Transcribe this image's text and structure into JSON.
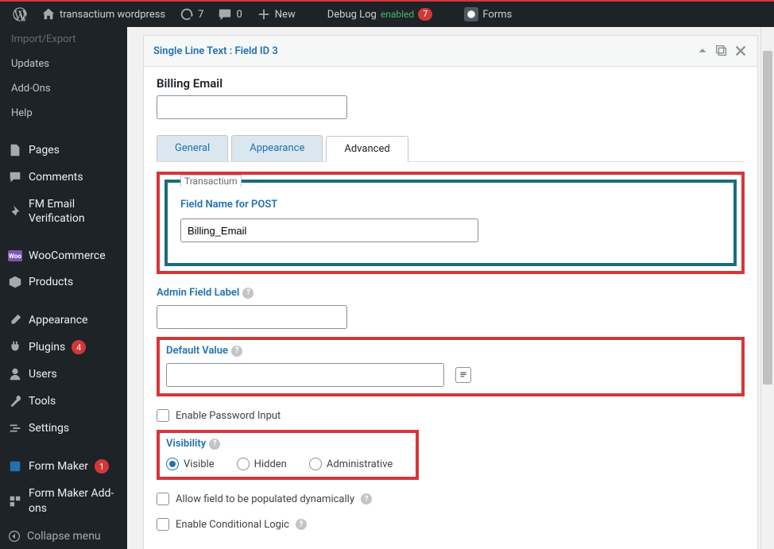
{
  "adminbar": {
    "site_name": "transactium wordpress",
    "updates_count": "7",
    "comments_count": "0",
    "new_label": "New",
    "debug_label": "Debug Log",
    "debug_status": "enabled",
    "debug_badge": "7",
    "forms_label": "Forms"
  },
  "sidebar": {
    "items_top": [
      "Import/Export",
      "Updates",
      "Add-Ons",
      "Help"
    ],
    "pages": "Pages",
    "comments": "Comments",
    "fm_email": "FM Email Verification",
    "woocommerce": "WooCommerce",
    "products": "Products",
    "appearance": "Appearance",
    "plugins": "Plugins",
    "plugins_badge": "4",
    "users": "Users",
    "tools": "Tools",
    "settings": "Settings",
    "form_maker": "Form Maker",
    "form_maker_badge": "1",
    "form_maker_addons": "Form Maker Add-ons",
    "collapse": "Collapse menu"
  },
  "panel": {
    "title": "Single Line Text : Field ID 3",
    "label": "Billing Email",
    "label_value": "",
    "tabs": {
      "general": "General",
      "appearance": "Appearance",
      "advanced": "Advanced"
    },
    "transactium_legend": "Transactium",
    "fieldname_label": "Field Name for POST",
    "fieldname_value": "Billing_Email",
    "admin_label": "Admin Field Label",
    "admin_value": "",
    "default_label": "Default Value",
    "default_value": "",
    "password_cb": "Enable Password Input",
    "visibility_label": "Visibility",
    "visibility_opts": {
      "visible": "Visible",
      "hidden": "Hidden",
      "admin": "Administrative"
    },
    "dynamic_cb": "Allow field to be populated dynamically",
    "conditional_cb": "Enable Conditional Logic"
  }
}
